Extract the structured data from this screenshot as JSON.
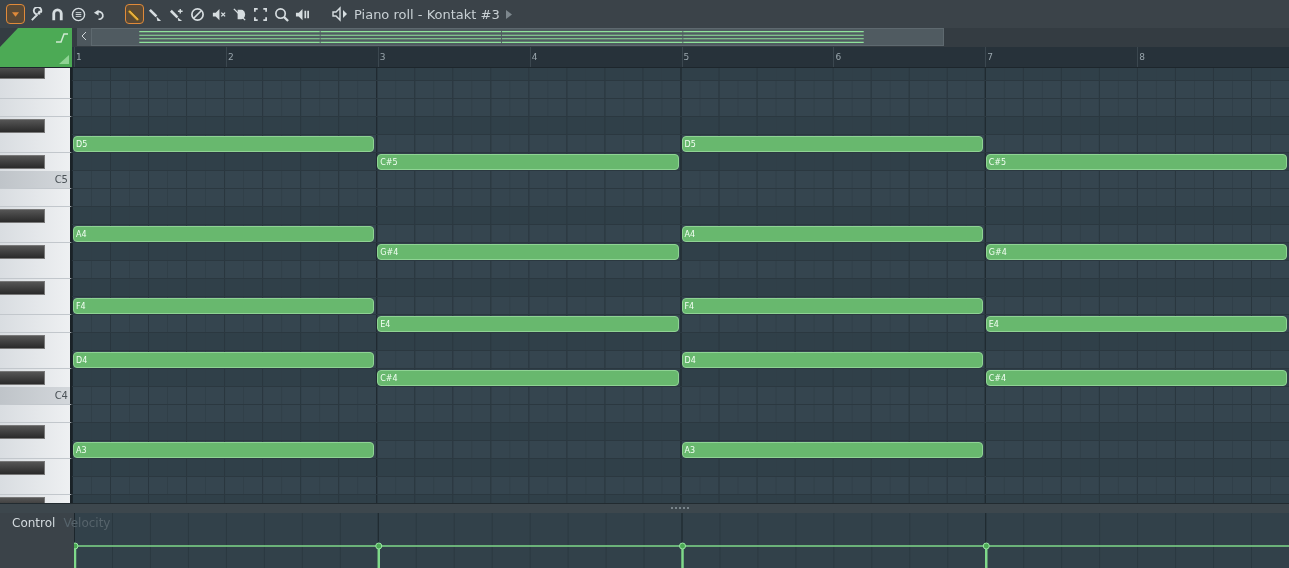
{
  "toolbar": {
    "tools": [
      {
        "kind": "menu",
        "selected": true
      },
      {
        "kind": "wrench",
        "selected": false
      },
      {
        "kind": "magnet",
        "selected": false
      },
      {
        "kind": "list",
        "selected": false
      },
      {
        "kind": "undo",
        "selected": false
      },
      {
        "kind": "pencil",
        "selected": true
      },
      {
        "kind": "brush",
        "selected": false
      },
      {
        "kind": "spray",
        "selected": false
      },
      {
        "kind": "delete",
        "selected": false
      },
      {
        "kind": "mute",
        "selected": false
      },
      {
        "kind": "slice",
        "selected": false
      },
      {
        "kind": "select",
        "selected": false
      },
      {
        "kind": "zoom",
        "selected": false
      },
      {
        "kind": "play",
        "selected": false
      }
    ],
    "title": "Piano roll - Kontakt #3"
  },
  "ruler": {
    "bars": [
      "1",
      "2",
      "3",
      "4",
      "5",
      "6",
      "7",
      "8"
    ]
  },
  "rows": [
    {
      "cells": [
        {
          "kind": "empty"
        },
        {
          "kind": "empty"
        },
        {
          "kind": "empty"
        },
        {
          "kind": "empty"
        }
      ]
    },
    {
      "cells": [
        {
          "kind": "empty"
        },
        {
          "kind": "empty"
        },
        {
          "kind": "empty"
        },
        {
          "kind": "empty"
        }
      ]
    },
    {
      "cells": [
        {
          "kind": "empty"
        },
        {
          "kind": "empty"
        },
        {
          "kind": "empty"
        },
        {
          "kind": "empty"
        }
      ]
    },
    {
      "cells": [
        {
          "kind": "empty"
        },
        {
          "kind": "empty"
        },
        {
          "kind": "empty"
        },
        {
          "kind": "empty"
        }
      ]
    },
    {
      "cells": [
        {
          "kind": "note",
          "label": "D5"
        },
        {
          "kind": "empty"
        },
        {
          "kind": "note",
          "label": "D5"
        },
        {
          "kind": "empty"
        }
      ]
    },
    {
      "cells": [
        {
          "kind": "empty"
        },
        {
          "kind": "note",
          "label": "C#5"
        },
        {
          "kind": "empty"
        },
        {
          "kind": "note",
          "label": "C#5"
        }
      ]
    },
    {
      "key_label": "C5",
      "cells": [
        {
          "kind": "empty"
        },
        {
          "kind": "empty"
        },
        {
          "kind": "empty"
        },
        {
          "kind": "empty"
        }
      ]
    },
    {
      "cells": [
        {
          "kind": "empty"
        },
        {
          "kind": "empty"
        },
        {
          "kind": "empty"
        },
        {
          "kind": "empty"
        }
      ]
    },
    {
      "cells": [
        {
          "kind": "empty"
        },
        {
          "kind": "empty"
        },
        {
          "kind": "empty"
        },
        {
          "kind": "empty"
        }
      ]
    },
    {
      "cells": [
        {
          "kind": "note",
          "label": "A4"
        },
        {
          "kind": "empty"
        },
        {
          "kind": "note",
          "label": "A4"
        },
        {
          "kind": "empty"
        }
      ]
    },
    {
      "cells": [
        {
          "kind": "empty"
        },
        {
          "kind": "note",
          "label": "G#4"
        },
        {
          "kind": "empty"
        },
        {
          "kind": "note",
          "label": "G#4"
        }
      ]
    },
    {
      "cells": [
        {
          "kind": "empty"
        },
        {
          "kind": "empty"
        },
        {
          "kind": "empty"
        },
        {
          "kind": "empty"
        }
      ]
    },
    {
      "cells": [
        {
          "kind": "empty"
        },
        {
          "kind": "empty"
        },
        {
          "kind": "empty"
        },
        {
          "kind": "empty"
        }
      ]
    },
    {
      "cells": [
        {
          "kind": "note",
          "label": "F4"
        },
        {
          "kind": "empty"
        },
        {
          "kind": "note",
          "label": "F4"
        },
        {
          "kind": "empty"
        }
      ]
    },
    {
      "cells": [
        {
          "kind": "empty"
        },
        {
          "kind": "note",
          "label": "E4"
        },
        {
          "kind": "empty"
        },
        {
          "kind": "note",
          "label": "E4"
        }
      ]
    },
    {
      "cells": [
        {
          "kind": "empty"
        },
        {
          "kind": "empty"
        },
        {
          "kind": "empty"
        },
        {
          "kind": "empty"
        }
      ]
    },
    {
      "cells": [
        {
          "kind": "note",
          "label": "D4"
        },
        {
          "kind": "empty"
        },
        {
          "kind": "note",
          "label": "D4"
        },
        {
          "kind": "empty"
        }
      ]
    },
    {
      "cells": [
        {
          "kind": "empty"
        },
        {
          "kind": "note",
          "label": "C#4"
        },
        {
          "kind": "empty"
        },
        {
          "kind": "note",
          "label": "C#4"
        }
      ]
    },
    {
      "key_label": "C4",
      "cells": [
        {
          "kind": "empty"
        },
        {
          "kind": "empty"
        },
        {
          "kind": "empty"
        },
        {
          "kind": "empty"
        }
      ]
    },
    {
      "cells": [
        {
          "kind": "empty"
        },
        {
          "kind": "empty"
        },
        {
          "kind": "empty"
        },
        {
          "kind": "empty"
        }
      ]
    },
    {
      "cells": [
        {
          "kind": "empty"
        },
        {
          "kind": "empty"
        },
        {
          "kind": "empty"
        },
        {
          "kind": "empty"
        }
      ]
    },
    {
      "cells": [
        {
          "kind": "note",
          "label": "A3"
        },
        {
          "kind": "empty"
        },
        {
          "kind": "note",
          "label": "A3"
        },
        {
          "kind": "empty"
        }
      ]
    },
    {
      "cells": [
        {
          "kind": "empty"
        },
        {
          "kind": "empty"
        },
        {
          "kind": "empty"
        },
        {
          "kind": "empty"
        }
      ]
    },
    {
      "cells": [
        {
          "kind": "empty"
        },
        {
          "kind": "empty"
        },
        {
          "kind": "empty"
        },
        {
          "kind": "empty"
        }
      ]
    },
    {
      "cells": [
        {
          "kind": "empty"
        },
        {
          "kind": "empty"
        },
        {
          "kind": "empty"
        },
        {
          "kind": "empty"
        }
      ]
    }
  ],
  "control": {
    "label": "Control",
    "target": "Velocity"
  }
}
